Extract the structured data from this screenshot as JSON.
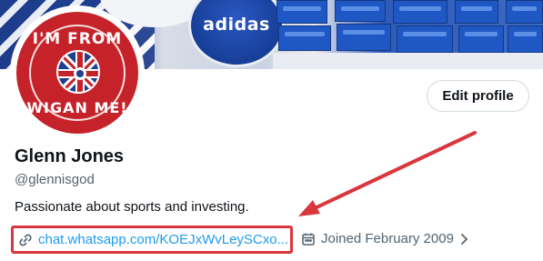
{
  "banner": {
    "brand_text": "adidas"
  },
  "avatar": {
    "text_top": "I'M FROM",
    "text_bottom": "WIGAN ME!"
  },
  "header": {
    "edit_profile_label": "Edit profile"
  },
  "profile": {
    "name": "Glenn Jones",
    "handle": "@glennisgod",
    "bio": "Passionate about sports and investing."
  },
  "meta": {
    "link_text": "chat.whatsapp.com/KOEJxWvLeySCxo...",
    "joined_text": "Joined February 2009"
  },
  "icons": {
    "link": "link-icon",
    "calendar": "calendar-icon",
    "chevron": "chevron-right-icon"
  },
  "colors": {
    "link": "#1d9bf0",
    "annotation": "#d9363e",
    "muted": "#536471"
  }
}
